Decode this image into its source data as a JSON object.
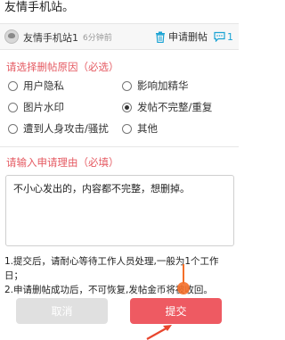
{
  "top_text": "友情手机站。",
  "post": {
    "author": "友情手机站1",
    "time": "6分钟前",
    "apply_delete": "申请删帖",
    "comment_count": "1"
  },
  "reasons_title": "请选择删帖原因（必选）",
  "reasons": [
    {
      "label": "用户隐私",
      "checked": false
    },
    {
      "label": "影响加精华",
      "checked": false
    },
    {
      "label": "图片水印",
      "checked": false
    },
    {
      "label": "发帖不完整/重复",
      "checked": true
    },
    {
      "label": "遭到人身攻击/骚扰",
      "checked": false
    },
    {
      "label": "其他",
      "checked": false
    }
  ],
  "reason_input_title": "请输入申请理由（必填）",
  "reason_text": "不小心发出的，内容都不完整，想删掉。",
  "notes": [
    "1.提交后，请耐心等待工作人员处理,一般为1个工作日；",
    "2.申请删帖成功后，不可恢复,发帖金币将被收回。"
  ],
  "buttons": {
    "cancel": "取消",
    "submit": "提交"
  },
  "colors": {
    "accent": "#ee5a62",
    "section_title": "#e55a62",
    "link_blue": "#1aa3d4",
    "pointer": "#f46f2a"
  }
}
